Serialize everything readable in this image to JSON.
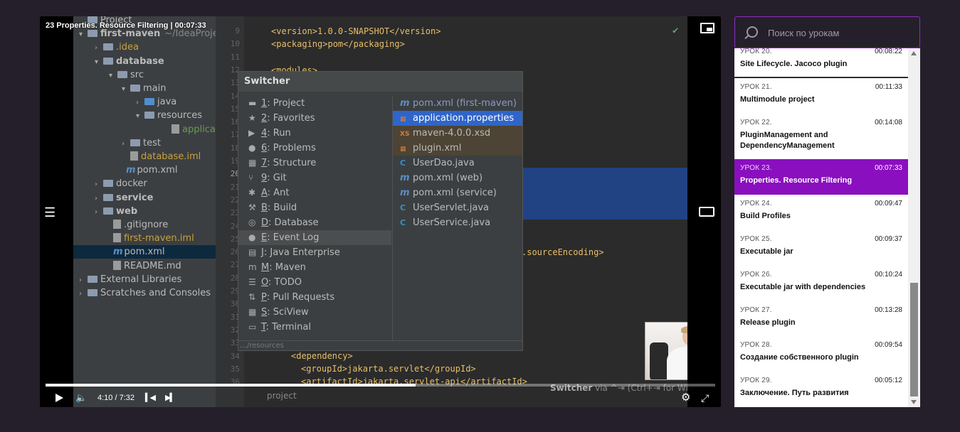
{
  "player": {
    "title": "23 Properties. Resource Filtering | 00:07:33",
    "time": "4:10 / 7:32",
    "progress": 0.553
  },
  "ide": {
    "tree": [
      {
        "label": "Project",
        "kind": "header"
      },
      {
        "label": "first-maven",
        "extra": "~/IdeaProjec",
        "kind": "root"
      },
      {
        "label": ".idea",
        "kind": "folder-yellow"
      },
      {
        "label": "database",
        "kind": "folder-bold"
      },
      {
        "label": "src",
        "kind": "folder"
      },
      {
        "label": "main",
        "kind": "folder"
      },
      {
        "label": "java",
        "kind": "folder-blue"
      },
      {
        "label": "resources",
        "kind": "folder"
      },
      {
        "label": "applicatio",
        "kind": "file-green"
      },
      {
        "label": "test",
        "kind": "folder"
      },
      {
        "label": "database.iml",
        "kind": "file-yellow"
      },
      {
        "label": "pom.xml",
        "kind": "m"
      },
      {
        "label": "docker",
        "kind": "folder"
      },
      {
        "label": "service",
        "kind": "folder-bold"
      },
      {
        "label": "web",
        "kind": "folder-bold"
      },
      {
        "label": ".gitignore",
        "kind": "file"
      },
      {
        "label": "first-maven.iml",
        "kind": "file-yellow"
      },
      {
        "label": "pom.xml",
        "kind": "m-sel"
      },
      {
        "label": "README.md",
        "kind": "file"
      },
      {
        "label": "External Libraries",
        "kind": "lib"
      },
      {
        "label": "Scratches and Consoles",
        "kind": "lib"
      }
    ],
    "line_numbers": [
      "9",
      "10",
      "11",
      "12",
      "13",
      "14",
      "15",
      "16",
      "17",
      "18",
      "19",
      "20",
      "21",
      "22",
      "23",
      "24",
      "25",
      "26",
      "27",
      "28",
      "29",
      "30",
      "31",
      "32",
      "33",
      "34",
      "35",
      "36"
    ],
    "code": {
      "version": "<version>1.0.0-SNAPSHOT</version>",
      "packaging": "<packaging>pom</packaging>",
      "modules": "<modules>",
      "source_encoding": ".sourceEncoding>",
      "dependency": "<dependency>",
      "group_id": "<groupId>jakarta.servlet</groupId>",
      "artifact_id": "<artifactId>jakarta.servlet-api</artifactId>"
    },
    "switcher": {
      "title": "Switcher",
      "tools": [
        {
          "key": "1",
          "label": ": Project",
          "icon": "▬"
        },
        {
          "key": "2",
          "label": ": Favorites",
          "icon": "★"
        },
        {
          "key": "4",
          "label": ": Run",
          "icon": "▶"
        },
        {
          "key": "6",
          "label": ": Problems",
          "icon": "●"
        },
        {
          "key": "7",
          "label": ": Structure",
          "icon": "▦"
        },
        {
          "key": "9",
          "label": ": Git",
          "icon": "⑂"
        },
        {
          "key": "A",
          "label": ": Ant",
          "icon": "✱"
        },
        {
          "key": "B",
          "label": ": Build",
          "icon": "⚒"
        },
        {
          "key": "D",
          "label": ": Database",
          "icon": "◎"
        },
        {
          "key": "E",
          "label": ": Event Log",
          "icon": "●"
        },
        {
          "key": "J",
          "label": ": Java Enterprise",
          "icon": "▤"
        },
        {
          "key": "M",
          "label": ": Maven",
          "icon": "m"
        },
        {
          "key": "O",
          "label": ": TODO",
          "icon": "☰"
        },
        {
          "key": "P",
          "label": ": Pull Requests",
          "icon": "⇅"
        },
        {
          "key": "S",
          "label": ": SciView",
          "icon": "▦"
        },
        {
          "key": "T",
          "label": ": Terminal",
          "icon": "▭"
        }
      ],
      "files": [
        {
          "label": "pom.xml (first-maven)",
          "icon": "m",
          "state": "dim"
        },
        {
          "label": "application.properties",
          "icon": "▦",
          "state": "sel"
        },
        {
          "label": "maven-4.0.0.xsd",
          "icon": "XS",
          "state": "brown"
        },
        {
          "label": "plugin.xml",
          "icon": "▦",
          "state": "brown"
        },
        {
          "label": "UserDao.java",
          "icon": "C",
          "state": ""
        },
        {
          "label": "pom.xml (web)",
          "icon": "m",
          "state": ""
        },
        {
          "label": "pom.xml (service)",
          "icon": "m",
          "state": ""
        },
        {
          "label": "UserServlet.java",
          "icon": "C",
          "state": ""
        },
        {
          "label": "UserService.java",
          "icon": "C",
          "state": ""
        }
      ],
      "path": "…/resources"
    },
    "hint_bold": "Switcher",
    "hint_rest": " via ^⇥ (Ctrl+⇥ for Win/Linux)",
    "bottom_label": "project"
  },
  "search": {
    "placeholder": "Поиск по урокам"
  },
  "lessons": [
    {
      "num": "УРОК 20.",
      "dur": "00:08:22",
      "title": "Site Lifecycle. Jacoco plugin",
      "active": false
    },
    {
      "num": "УРОК 21.",
      "dur": "00:11:33",
      "title": "Multimodule project",
      "active": false
    },
    {
      "num": "УРОК 22.",
      "dur": "00:14:08",
      "title": "PluginManagement and DependencyManagement",
      "active": false
    },
    {
      "num": "УРОК 23.",
      "dur": "00:07:33",
      "title": "Properties. Resource Filtering",
      "active": true
    },
    {
      "num": "УРОК 24.",
      "dur": "00:09:47",
      "title": "Build Profiles",
      "active": false
    },
    {
      "num": "УРОК 25.",
      "dur": "00:09:37",
      "title": "Executable jar",
      "active": false
    },
    {
      "num": "УРОК 26.",
      "dur": "00:10:24",
      "title": "Executable jar with dependencies",
      "active": false
    },
    {
      "num": "УРОК 27.",
      "dur": "00:13:28",
      "title": "Release plugin",
      "active": false
    },
    {
      "num": "УРОК 28.",
      "dur": "00:09:54",
      "title": "Создание собственного plugin",
      "active": false
    },
    {
      "num": "УРОК 29.",
      "dur": "00:05:12",
      "title": "Заключение. Путь развития",
      "active": false
    }
  ],
  "colors": {
    "accent": "#8a0fbf",
    "background": "#251f2b"
  }
}
